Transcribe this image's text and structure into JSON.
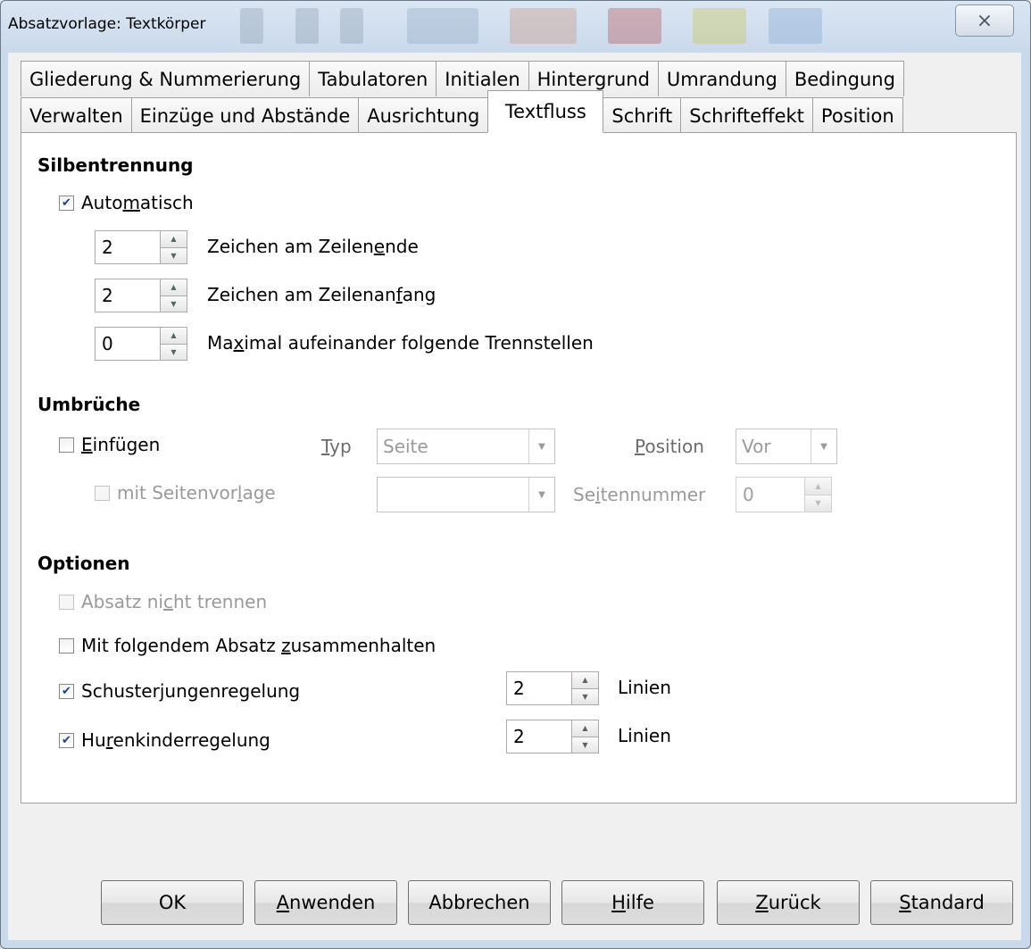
{
  "window": {
    "title": "Absatzvorlage: Textkörper",
    "close_icon": "⨯"
  },
  "tabs": {
    "row1": [
      "Gliederung & Nummerierung",
      "Tabulatoren",
      "Initialen",
      "Hintergrund",
      "Umrandung",
      "Bedingung"
    ],
    "row2": [
      "Verwalten",
      "Einzüge und Abstände",
      "Ausrichtung",
      "Textfluss",
      "Schrift",
      "Schrifteffekt",
      "Position"
    ],
    "active": "Textfluss"
  },
  "hyphenation": {
    "heading": "Silbentrennung",
    "auto": {
      "label_pre": "Auto",
      "label_key": "m",
      "label_post": "atisch",
      "checked": true
    },
    "end_chars": {
      "value": "2",
      "label_pre": "Zeichen am Zeilen",
      "label_key": "e",
      "label_post": "nde"
    },
    "start_chars": {
      "value": "2",
      "label_pre": "Zeichen am Zeilenan",
      "label_key": "f",
      "label_post": "ang"
    },
    "max_hyphens": {
      "value": "0",
      "label_pre": "Ma",
      "label_key": "x",
      "label_post": "imal aufeinander folgende Trennstellen"
    }
  },
  "breaks": {
    "heading": "Umbrüche",
    "insert": {
      "label_key": "E",
      "label_post": "infügen",
      "checked": false
    },
    "type_label_key": "T",
    "type_label_post": "yp",
    "type_value": "Seite",
    "position_label_key": "P",
    "position_label_post": "osition",
    "position_value": "Vor",
    "with_style": {
      "label_pre": "mit Seitenvor",
      "label_key": "l",
      "label_post": "age",
      "checked": false
    },
    "style_value": "",
    "page_number_label_pre": "Se",
    "page_number_label_key": "i",
    "page_number_label_post": "tennummer",
    "page_number_value": "0"
  },
  "options": {
    "heading": "Optionen",
    "keep_together": {
      "label_pre": "Absatz ni",
      "label_key": "c",
      "label_post": "ht trennen",
      "checked": false
    },
    "keep_with_next": {
      "label_pre": "Mit folgendem Absatz ",
      "label_key": "z",
      "label_post": "usammenhalten",
      "checked": false
    },
    "orphan": {
      "label_pre": "Schuster",
      "label_key": "j",
      "label_post": "ungenregelung",
      "checked": true,
      "value": "2",
      "unit": "Linien"
    },
    "widow": {
      "label_pre": "Hu",
      "label_key": "r",
      "label_post": "enkinderregelung",
      "checked": true,
      "value": "2",
      "unit": "Linien"
    }
  },
  "buttons": {
    "ok": "OK",
    "apply": {
      "key": "A",
      "post": "nwenden"
    },
    "cancel": "Abbrechen",
    "help": {
      "key": "H",
      "post": "ilfe"
    },
    "reset": {
      "key": "Z",
      "post": "urück"
    },
    "standard": {
      "key": "S",
      "post": "tandard"
    }
  },
  "colors": {
    "check": "#1f3f8c",
    "frame": "#c9d8ea"
  }
}
